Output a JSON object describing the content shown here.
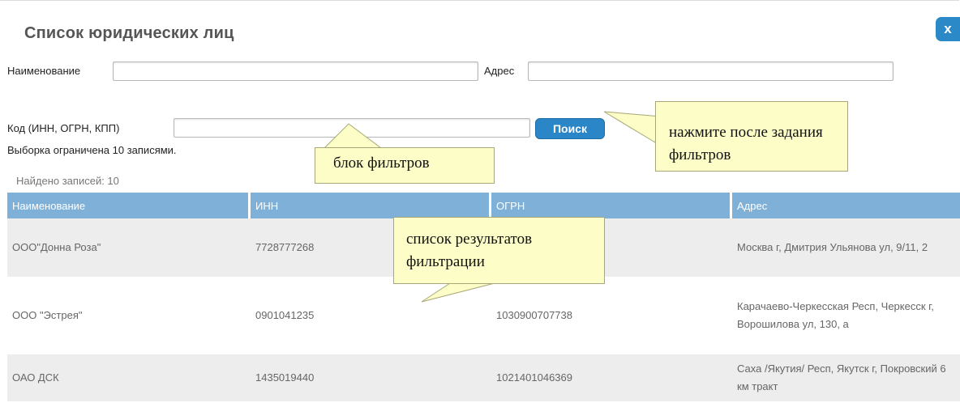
{
  "dialog": {
    "title": "Список юридических лиц",
    "close_label": "x"
  },
  "filters": {
    "name_label": "Наименование",
    "name_value": "",
    "address_label": "Адрес",
    "address_value": "",
    "code_label": "Код (ИНН, ОГРН, КПП)",
    "code_value": "",
    "search_button": "Поиск"
  },
  "limit_note": "Выборка ограничена 10 записями.",
  "found_text": "Найдено записей: 10",
  "table": {
    "headers": [
      "Наименование",
      "ИНН",
      "ОГРН",
      "Адрес"
    ],
    "rows": [
      {
        "name": "ООО\"Донна Роза\"",
        "inn": "7728777268",
        "ogrn": "",
        "address": "Москва г, Дмитрия Ульянова ул, 9/11, 2"
      },
      {
        "name": "ООО \"Эстрея\"",
        "inn": "0901041235",
        "ogrn": "1030900707738",
        "address": "Карачаево-Черкесская Респ, Черкесск г, Ворошилова ул, 130, а"
      },
      {
        "name": "ОАО ДСК",
        "inn": "1435019440",
        "ogrn": "1021401046369",
        "address": "Саха /Якутия/ Респ, Якутск г, Покровский 6 км тракт"
      }
    ]
  },
  "callouts": {
    "search_hint": "нажмите после задания фильтров",
    "filters_hint": "блок фильтров",
    "results_hint": "список результатов фильтрации"
  },
  "colors": {
    "accent": "#2a86c7",
    "header_bg": "#7fb1d8",
    "callout_bg": "#fdfdc7"
  }
}
